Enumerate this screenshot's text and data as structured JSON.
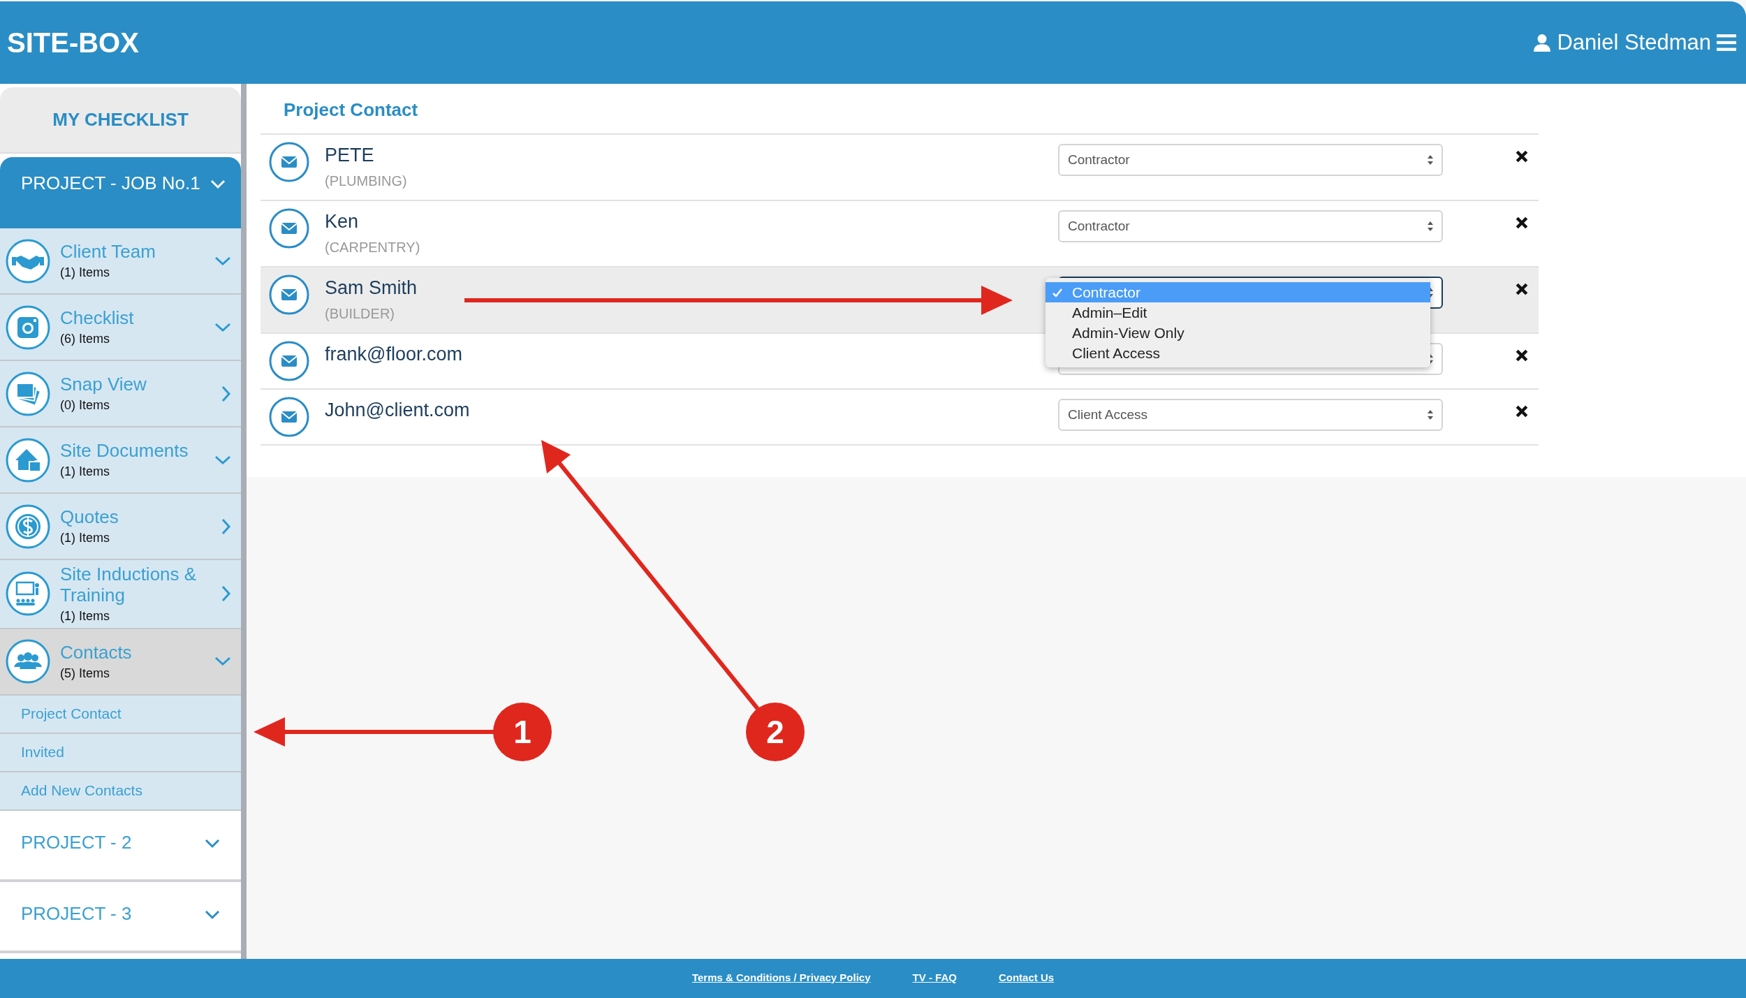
{
  "header": {
    "title": "SITE-BOX",
    "user": "Daniel Stedman"
  },
  "sidebar": {
    "checklist_tab": "MY CHECKLIST",
    "projects": [
      {
        "title": "PROJECT - JOB No.1",
        "expanded": true,
        "items": [
          {
            "title": "Client Team",
            "count": "(1) Items",
            "kind": "expand",
            "selected": false
          },
          {
            "title": "Checklist",
            "count": "(6) Items",
            "kind": "expand",
            "selected": false
          },
          {
            "title": "Snap View",
            "count": "(0) Items",
            "kind": "link",
            "selected": false
          },
          {
            "title": "Site Documents",
            "count": "(1) Items",
            "kind": "expand",
            "selected": false
          },
          {
            "title": "Quotes",
            "count": "(1) Items",
            "kind": "link",
            "selected": false
          },
          {
            "title": "Site Inductions & Training",
            "count": "(1) Items",
            "kind": "link",
            "selected": false
          },
          {
            "title": "Contacts",
            "count": "(5) Items",
            "kind": "expand",
            "selected": true,
            "children": [
              {
                "label": "Project Contact"
              },
              {
                "label": "Invited"
              },
              {
                "label": "Add New Contacts"
              }
            ]
          }
        ]
      },
      {
        "title": "PROJECT - 2",
        "expanded": false
      },
      {
        "title": "PROJECT - 3",
        "expanded": false
      }
    ]
  },
  "main": {
    "heading": "Project Contact",
    "contacts": [
      {
        "name": "PETE",
        "trade": "(PLUMBING)",
        "role": "Contractor",
        "selected": false
      },
      {
        "name": "Ken",
        "trade": "(CARPENTRY)",
        "role": "Contractor",
        "selected": false
      },
      {
        "name": "Sam Smith",
        "trade": "(BUILDER)",
        "selected": true,
        "menu": [
          {
            "label": "Contractor",
            "selected": true
          },
          {
            "label": "Admin–Edit",
            "selected": false
          },
          {
            "label": "Admin-View Only",
            "selected": false
          },
          {
            "label": "Client Access",
            "selected": false
          }
        ]
      },
      {
        "name": "frank@floor.com",
        "selected": false
      },
      {
        "name": "John@client.com",
        "role": "Client Access",
        "selected": false
      }
    ]
  },
  "annotations": [
    {
      "label": "1"
    },
    {
      "label": "2"
    }
  ],
  "footer": {
    "links": [
      "Terms & Conditions / Privacy Policy",
      "TV - FAQ",
      "Contact Us"
    ]
  }
}
